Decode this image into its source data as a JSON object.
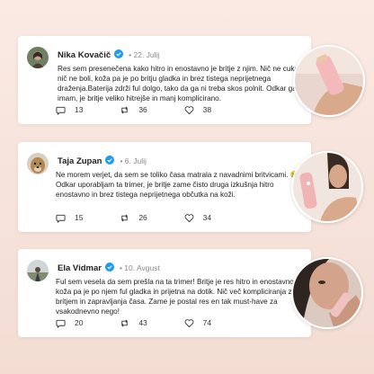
{
  "posts": [
    {
      "name": "Nika Kovačič",
      "date": "22. Julij",
      "text": " Res sem presenečena kako hitro in enostavno je britje z njim. Nič ne cuka nič ne boli, koža pa je po britju gladka in brez tistega neprijetnega draženja.Baterija zdrži ful dolgo, tako da ga ni treba skos polnit. Odkar ga imam, je britje veliko hitrejše in manj komplicirano.",
      "comments": "13",
      "reposts": "36",
      "likes": "38"
    },
    {
      "name": "Taja Zupan",
      "date": "6. Julij",
      "text": "Ne morem verjet, da sem se toliko časa matrala z navadnimi britvicami. 😢 Odkar uporabljam ta trimer, je britje zame čisto druga izkušnja hitro enostavno in brez tistega neprijetnega občutka na koži.",
      "comments": "15",
      "reposts": "26",
      "likes": "34"
    },
    {
      "name": "Ela Vidmar",
      "date": "10. Avgust",
      "text": "Ful sem vesela da sem prešla na ta trimer! Britje je res hitro in enostavno, koža pa je po njem ful gladka in prijetna na dotik. Nič več kompliciranja z britjem in zapravljanja časa. Zame je postal res en tak must-have za vsakodnevno nego!",
      "comments": "20",
      "reposts": "43",
      "likes": "74"
    }
  ],
  "icons": {
    "verified": "verified-badge-icon",
    "comment": "comment-icon",
    "repost": "repost-icon",
    "like": "heart-icon"
  },
  "colors": {
    "verified": "#1d9bf0",
    "background": "#f6e3db",
    "card": "#ffffff"
  }
}
